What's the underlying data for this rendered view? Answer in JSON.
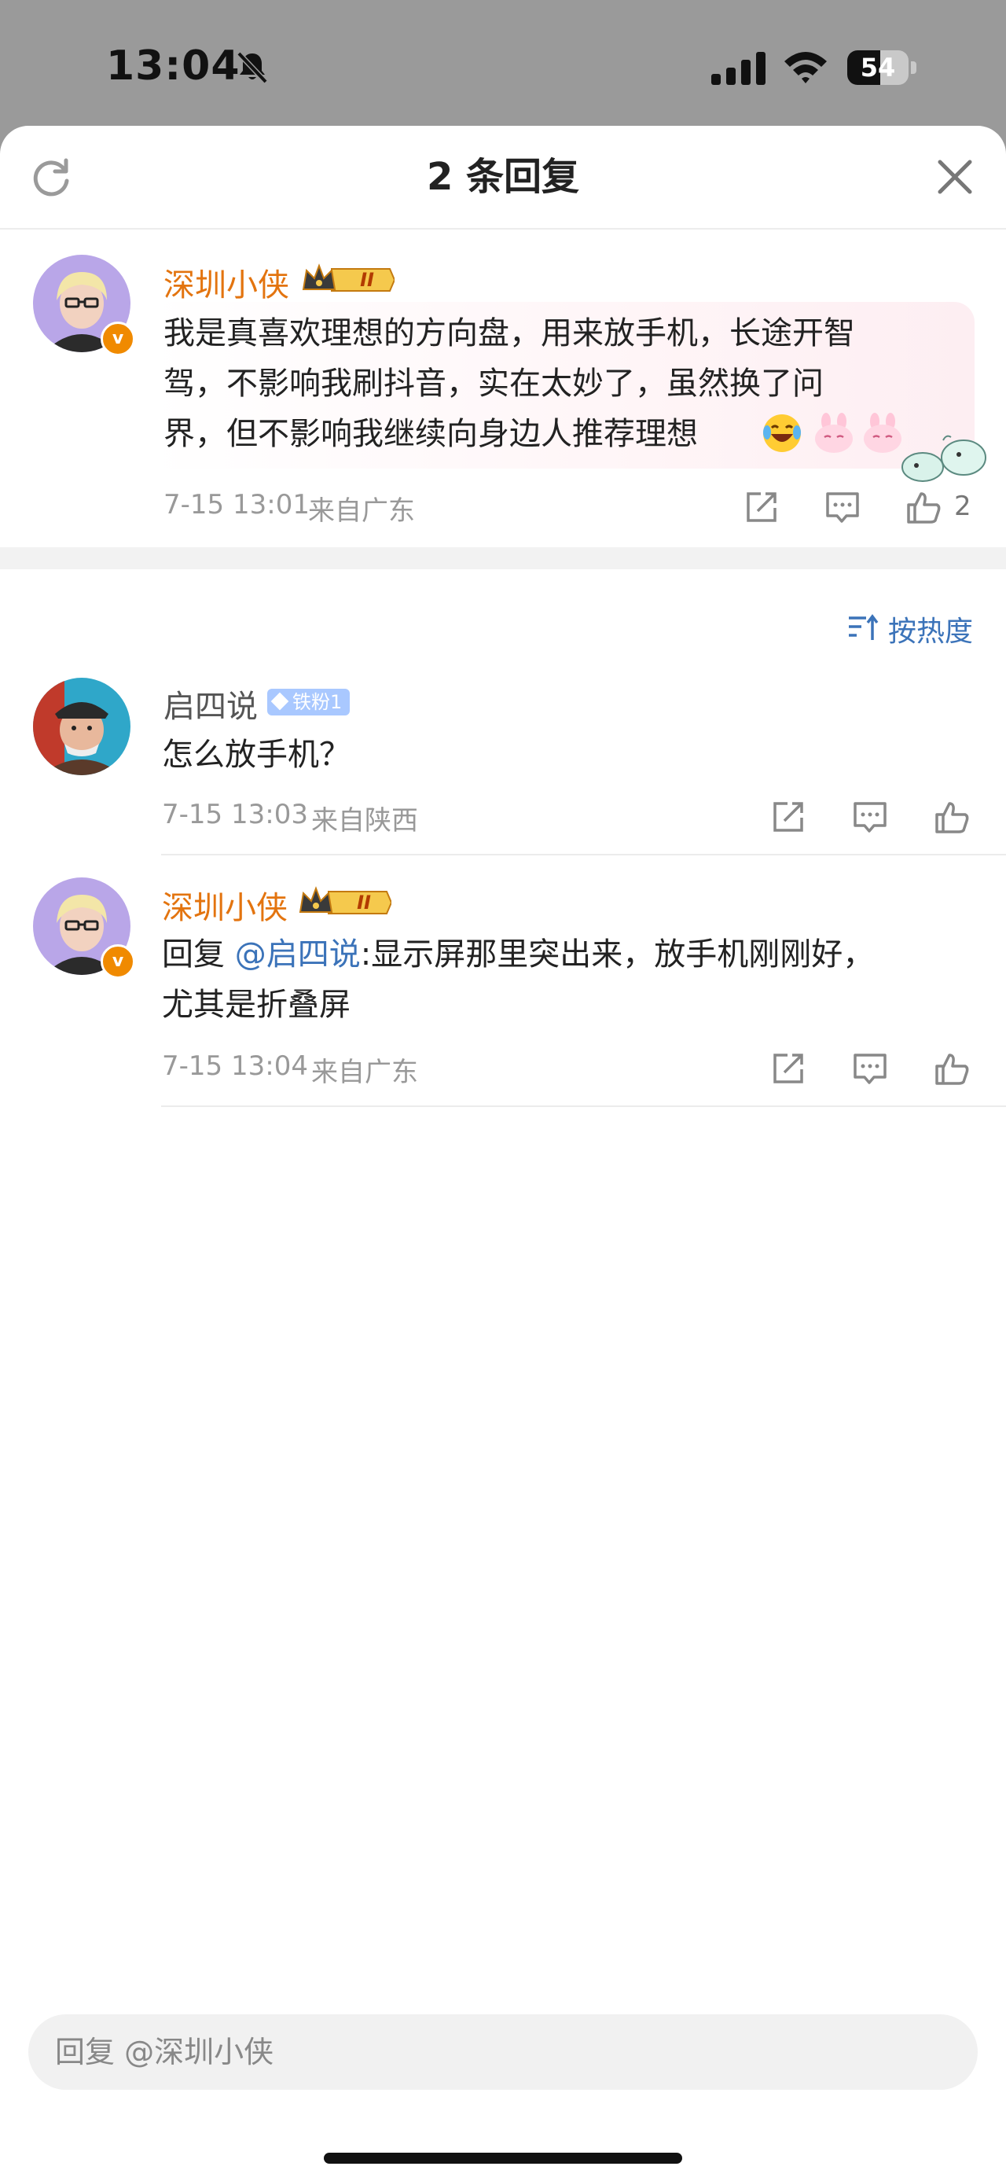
{
  "status_bar": {
    "time": "13:04",
    "battery": "54",
    "battery_level": 0.54
  },
  "sheet": {
    "title": "2 条回复"
  },
  "main_comment": {
    "username": "深圳小侠",
    "level_badge": "II",
    "text_lines": [
      "我是真喜欢理想的方向盘，用来放手机，长途开智",
      "驾，不影响我刷抖音，实在太妙了，虽然换了问",
      "界，但不影响我继续向身边人推荐理想"
    ],
    "date": "7-15 13:01",
    "location": "来自广东",
    "like_count": "2"
  },
  "sort": {
    "label": "按热度"
  },
  "replies": [
    {
      "username": "启四说",
      "fan_badge": "铁粉1",
      "text": "怎么放手机？",
      "date": "7-15 13:03",
      "location": "来自陕西"
    },
    {
      "username": "深圳小侠",
      "level_badge": "II",
      "reply_prefix": "回复 ",
      "mention": "@启四说",
      "text_line1": ":显示屏那里突出来，放手机刚刚好，",
      "text_line2": "尤其是折叠屏",
      "date": "7-15 13:04",
      "location": "来自广东"
    }
  ],
  "composer": {
    "placeholder": "回复 @深圳小侠"
  },
  "colors": {
    "accent_orange": "#e3740f",
    "link_blue": "#3b73b9",
    "verified_orange": "#f08a00"
  }
}
